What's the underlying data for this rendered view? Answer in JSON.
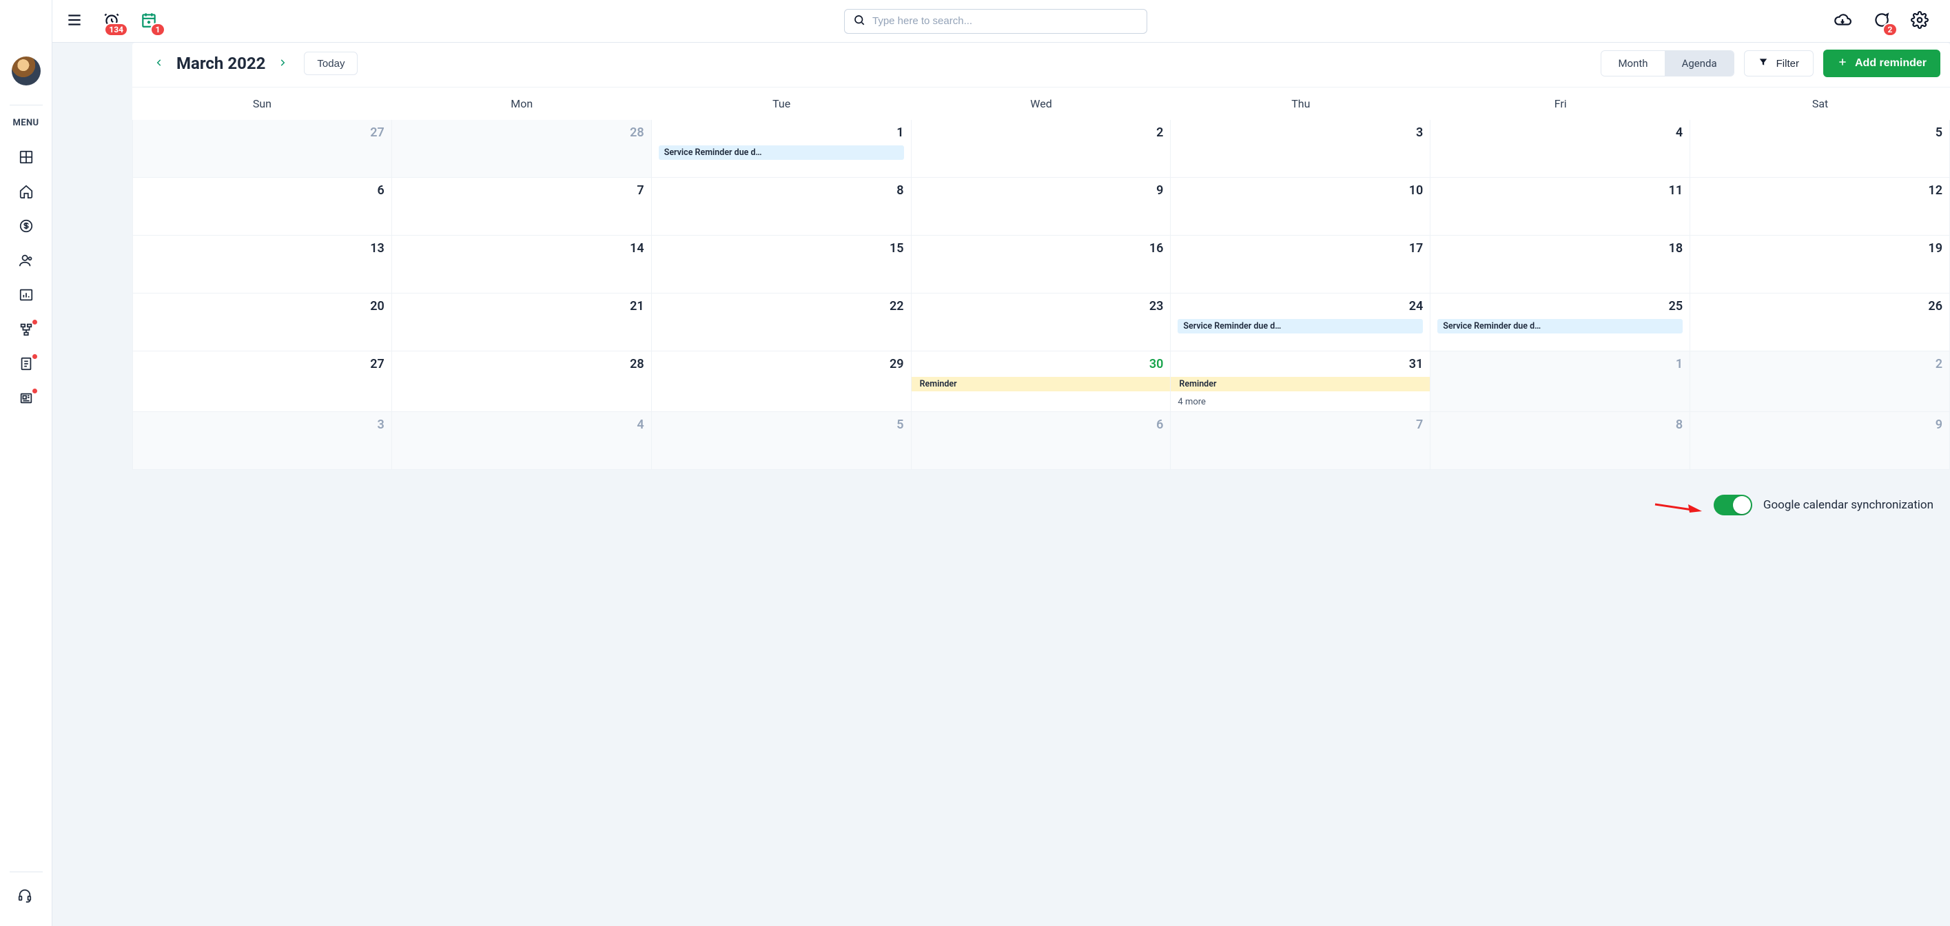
{
  "topbar": {
    "alarm_badge": "134",
    "calendar_badge": "1",
    "search_placeholder": "Type here to search...",
    "messages_badge": "2"
  },
  "sidebar": {
    "menu_label": "MENU"
  },
  "calendar": {
    "title": "March 2022",
    "today_label": "Today",
    "view_month": "Month",
    "view_agenda": "Agenda",
    "filter_label": "Filter",
    "add_label": "Add reminder",
    "dow": [
      "Sun",
      "Mon",
      "Tue",
      "Wed",
      "Thu",
      "Fri",
      "Sat"
    ],
    "weeks": [
      [
        {
          "n": "27",
          "out": true
        },
        {
          "n": "28",
          "out": true
        },
        {
          "n": "1",
          "events": [
            {
              "t": "Service Reminder due d…",
              "c": "blue"
            }
          ]
        },
        {
          "n": "2"
        },
        {
          "n": "3"
        },
        {
          "n": "4"
        },
        {
          "n": "5"
        }
      ],
      [
        {
          "n": "6"
        },
        {
          "n": "7"
        },
        {
          "n": "8"
        },
        {
          "n": "9"
        },
        {
          "n": "10"
        },
        {
          "n": "11"
        },
        {
          "n": "12"
        }
      ],
      [
        {
          "n": "13"
        },
        {
          "n": "14"
        },
        {
          "n": "15"
        },
        {
          "n": "16"
        },
        {
          "n": "17"
        },
        {
          "n": "18"
        },
        {
          "n": "19"
        }
      ],
      [
        {
          "n": "20"
        },
        {
          "n": "21"
        },
        {
          "n": "22"
        },
        {
          "n": "23"
        },
        {
          "n": "24",
          "events": [
            {
              "t": "Service Reminder due d…",
              "c": "blue"
            }
          ]
        },
        {
          "n": "25",
          "events": [
            {
              "t": "Service Reminder due d…",
              "c": "blue"
            }
          ]
        },
        {
          "n": "26"
        }
      ],
      [
        {
          "n": "27"
        },
        {
          "n": "28"
        },
        {
          "n": "29"
        },
        {
          "n": "30",
          "today": true,
          "events": [
            {
              "t": "Reminder",
              "c": "yellow"
            }
          ]
        },
        {
          "n": "31",
          "events": [
            {
              "t": "Reminder",
              "c": "yellow"
            }
          ],
          "more": "4 more"
        },
        {
          "n": "1",
          "out": true
        },
        {
          "n": "2",
          "out": true
        }
      ],
      [
        {
          "n": "3",
          "out": true
        },
        {
          "n": "4",
          "out": true
        },
        {
          "n": "5",
          "out": true
        },
        {
          "n": "6",
          "out": true
        },
        {
          "n": "7",
          "out": true
        },
        {
          "n": "8",
          "out": true
        },
        {
          "n": "9",
          "out": true
        }
      ]
    ]
  },
  "sync": {
    "label": "Google calendar synchronization",
    "enabled": true
  }
}
